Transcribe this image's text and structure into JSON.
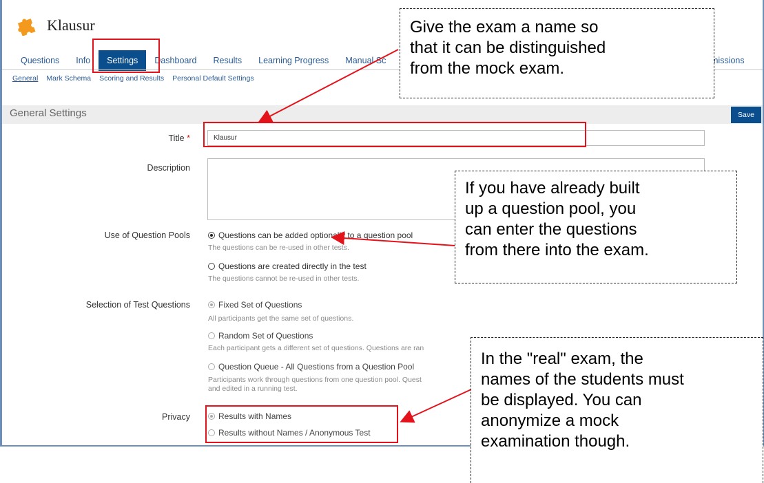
{
  "header": {
    "title": "Klausur",
    "logo_icon": "puzzle-icon"
  },
  "tabs": [
    {
      "label": "Questions"
    },
    {
      "label": "Info"
    },
    {
      "label": "Settings",
      "active": true
    },
    {
      "label": "Dashboard"
    },
    {
      "label": "Results"
    },
    {
      "label": "Learning Progress"
    },
    {
      "label": "Manual Sc"
    }
  ],
  "tab_tail": "missions",
  "subtabs": [
    {
      "label": "General",
      "active": true
    },
    {
      "label": "Mark Schema"
    },
    {
      "label": "Scoring and Results"
    },
    {
      "label": "Personal Default Settings"
    }
  ],
  "section": {
    "title": "General Settings",
    "save_label": "Save"
  },
  "form": {
    "title_label": "Title",
    "required_mark": "*",
    "title_value": "Klausur",
    "description_label": "Description",
    "pools_label": "Use of Question Pools",
    "pools_opt1": "Questions can be added optionally to a question pool",
    "pools_opt1_help": "The questions can be re-used in other tests.",
    "pools_opt2": "Questions are created directly in the test",
    "pools_opt2_help": "The questions cannot be re-used in other tests.",
    "selection_label": "Selection of Test Questions",
    "sel_opt1": "Fixed Set of Questions",
    "sel_opt1_help": "All participants get the same set of questions.",
    "sel_opt2": "Random Set of Questions",
    "sel_opt2_help": "Each participant gets a different set of questions. Questions are ran",
    "sel_opt3": "Question Queue - All Questions from a Question Pool",
    "sel_opt3_help1": "Participants work through questions from one question pool. Quest",
    "sel_opt3_help2": "and edited in a running test.",
    "privacy_label": "Privacy",
    "privacy_opt1": "Results with Names",
    "privacy_opt2": "Results without Names / Anonymous Test"
  },
  "callouts": {
    "title_note": [
      "Give the exam a name so",
      "that it can be distinguished",
      "from the mock exam."
    ],
    "pool_note": [
      "If you have already built",
      "up a question pool, you",
      "can enter the questions",
      "from there into the exam."
    ],
    "privacy_note": [
      "In the \"real\" exam, the",
      "names of the students must",
      "be displayed. You can",
      "anonymize a mock",
      "examination though."
    ]
  },
  "colors": {
    "accent": "#0b4e8e",
    "highlight": "#e3131b",
    "link": "#2a5b97"
  }
}
